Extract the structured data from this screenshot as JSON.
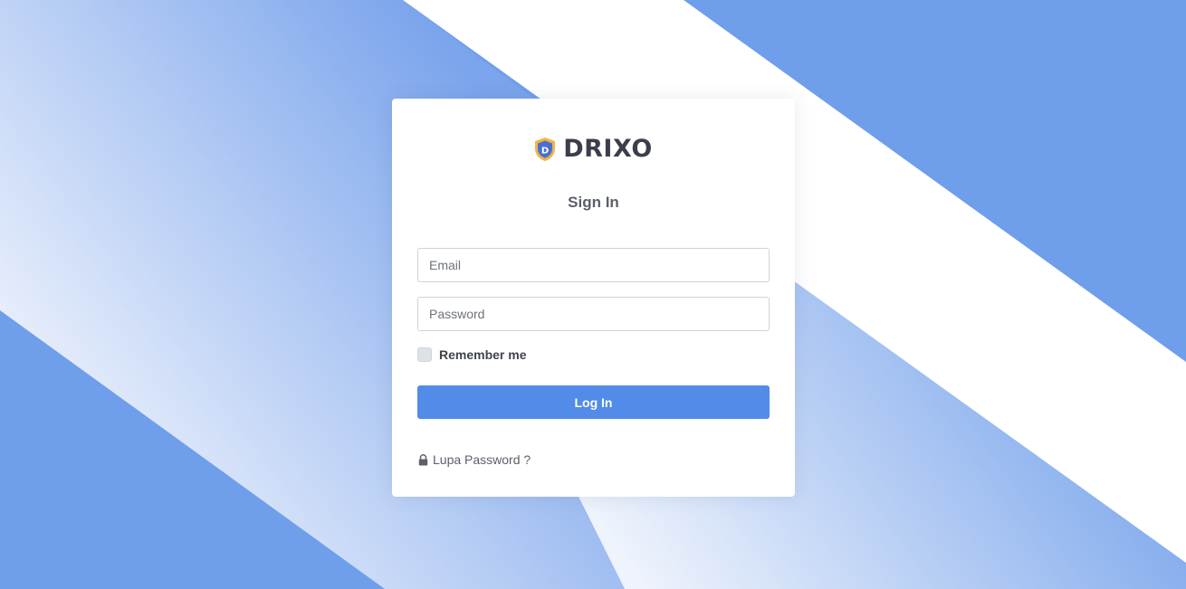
{
  "brand": {
    "name": "DRIXO",
    "logo_letter": "D"
  },
  "login": {
    "title": "Sign In",
    "email_placeholder": "Email",
    "password_placeholder": "Password",
    "remember_label": "Remember me",
    "login_button_label": "Log In",
    "forgot_link_label": "Lupa Password ?"
  },
  "colors": {
    "background_blue": "#6f9eea",
    "stripe_white": "#ffffff",
    "button_blue": "#528be8",
    "logo_shield_gold": "#f0b545",
    "logo_shield_blue": "#4a6fd1",
    "text_dark": "#3b3f4c"
  },
  "icons": {
    "logo": "shield-icon",
    "forgot": "lock-icon"
  }
}
